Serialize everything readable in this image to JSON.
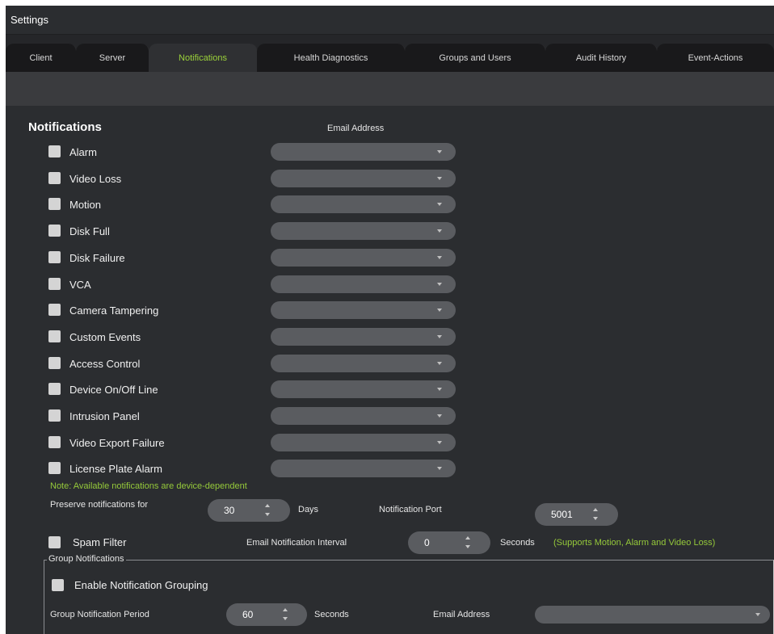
{
  "window": {
    "title": "Settings"
  },
  "tabs": [
    {
      "label": "Client",
      "active": false
    },
    {
      "label": "Server",
      "active": false
    },
    {
      "label": "Notifications",
      "active": true
    },
    {
      "label": "Health Diagnostics",
      "active": false
    },
    {
      "label": "Groups and Users",
      "active": false
    },
    {
      "label": "Audit History",
      "active": false
    },
    {
      "label": "Event-Actions",
      "active": false
    }
  ],
  "notifications": {
    "section_title": "Notifications",
    "email_column_header": "Email Address",
    "items": [
      {
        "label": "Alarm",
        "checked": false,
        "email": ""
      },
      {
        "label": "Video Loss",
        "checked": false,
        "email": ""
      },
      {
        "label": "Motion",
        "checked": false,
        "email": ""
      },
      {
        "label": "Disk Full",
        "checked": false,
        "email": ""
      },
      {
        "label": "Disk Failure",
        "checked": false,
        "email": ""
      },
      {
        "label": "VCA",
        "checked": false,
        "email": ""
      },
      {
        "label": "Camera Tampering",
        "checked": false,
        "email": ""
      },
      {
        "label": "Custom Events",
        "checked": false,
        "email": ""
      },
      {
        "label": "Access Control",
        "checked": false,
        "email": ""
      },
      {
        "label": "Device On/Off Line",
        "checked": false,
        "email": ""
      },
      {
        "label": "Intrusion Panel",
        "checked": false,
        "email": ""
      },
      {
        "label": "Video Export Failure",
        "checked": false,
        "email": ""
      },
      {
        "label": "License Plate Alarm",
        "checked": false,
        "email": ""
      }
    ],
    "note": "Note: Available notifications are device-dependent"
  },
  "preserve": {
    "label": "Preserve notifications for",
    "value": "30",
    "unit": "Days"
  },
  "port": {
    "label": "Notification Port",
    "value": "5001"
  },
  "spam": {
    "label": "Spam Filter",
    "checked": false,
    "interval_label": "Email Notification Interval",
    "interval_value": "0",
    "unit": "Seconds",
    "hint": "(Supports Motion, Alarm and Video Loss)"
  },
  "group": {
    "legend": "Group Notifications",
    "enable_label": "Enable Notification Grouping",
    "enable_checked": false,
    "period_label": "Group Notification Period",
    "period_value": "60",
    "period_unit": "Seconds",
    "email_label": "Email Address",
    "email_value": ""
  },
  "colors": {
    "window_bg": "#2b2d30",
    "accent_green": "#9bd23a",
    "control_fill": "#5a5c60",
    "checkbox_fill": "#d4d4d4"
  }
}
